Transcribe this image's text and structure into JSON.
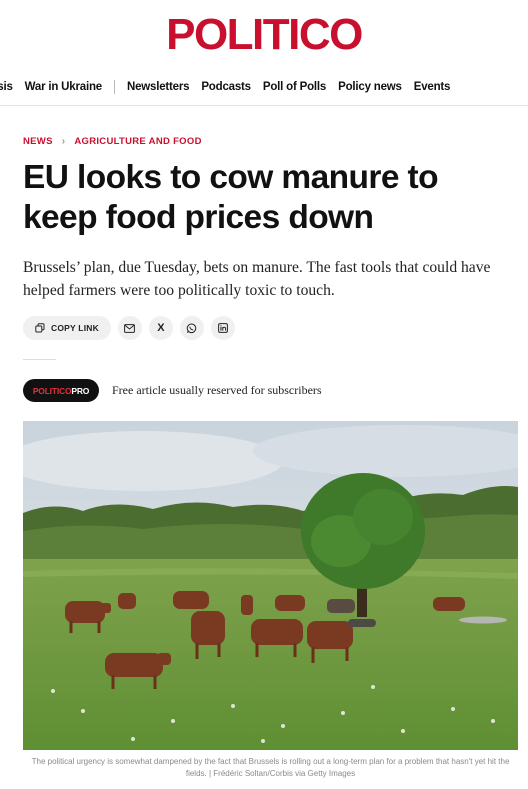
{
  "brand": {
    "logo_text": "POLITICO",
    "accent_color": "#c8102e"
  },
  "nav": {
    "items": [
      "risis",
      "War in Ukraine",
      "Newsletters",
      "Podcasts",
      "Poll of Polls",
      "Policy news",
      "Events"
    ]
  },
  "breadcrumb": {
    "section": "NEWS",
    "subsection": "AGRICULTURE AND FOOD"
  },
  "article": {
    "headline": "EU looks to cow manure to keep food prices down",
    "dek": "Brussels’ plan, due Tuesday, bets on manure. The fast tools that could have helped farmers were too politically toxic to touch.",
    "share": {
      "copy_link_label": "COPY LINK",
      "icons": [
        "mail-icon",
        "x-icon",
        "whatsapp-icon",
        "linkedin-icon"
      ],
      "x_glyph": "X"
    },
    "pro": {
      "badge_part1": "POLITICO",
      "badge_part2": "PRO",
      "note": "Free article usually reserved for subscribers"
    },
    "image_caption": "The political urgency is somewhat dampened by the fact that Brussels is rolling out a long-term plan for a problem that hasn't yet hit the fields. | Frédéric Soltan/Corbis via Getty Images"
  }
}
